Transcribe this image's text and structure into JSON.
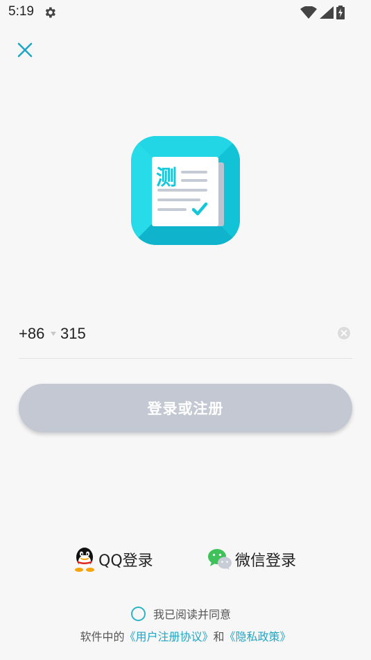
{
  "status_bar": {
    "time": "5:19"
  },
  "colors": {
    "accent": "#1fa6c4",
    "button_disabled": "#c3c8d2",
    "logo_cyan": "#16d0e0"
  },
  "logo": {
    "char": "测"
  },
  "phone": {
    "country_code": "+86",
    "value": "315"
  },
  "login_button": {
    "label": "登录或注册"
  },
  "third_party": {
    "qq_label": "QQ登录",
    "wechat_label": "微信登录"
  },
  "agreement": {
    "text": "我已阅读并同意",
    "prefix": "软件中的",
    "user_agreement": "《用户注册协议》",
    "and": "和",
    "privacy_policy": "《隐私政策》"
  }
}
